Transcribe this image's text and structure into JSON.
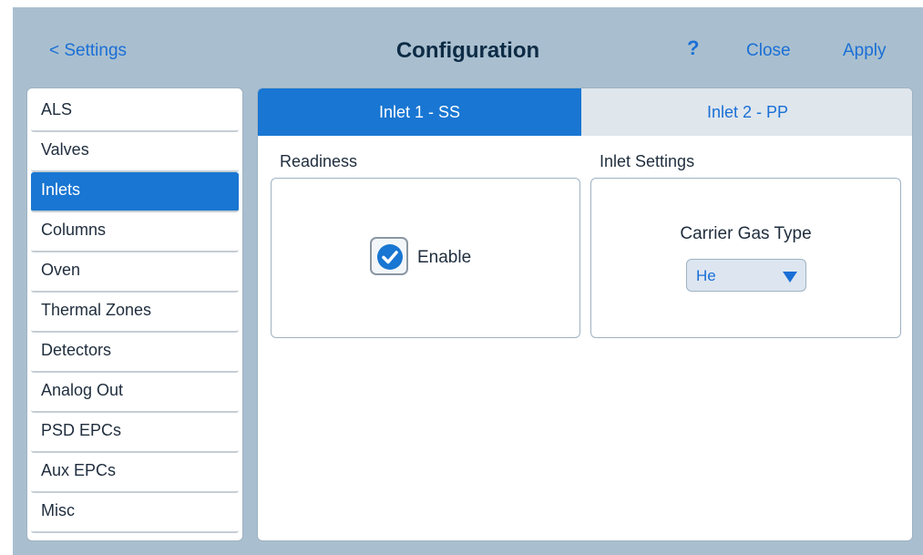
{
  "header": {
    "back_label": "< Settings",
    "title": "Configuration",
    "help_label": "?",
    "close_label": "Close",
    "apply_label": "Apply"
  },
  "sidebar": {
    "items": [
      {
        "label": "ALS"
      },
      {
        "label": "Valves"
      },
      {
        "label": "Inlets",
        "active": true
      },
      {
        "label": "Columns"
      },
      {
        "label": "Oven"
      },
      {
        "label": "Thermal Zones"
      },
      {
        "label": "Detectors"
      },
      {
        "label": "Analog Out"
      },
      {
        "label": "PSD EPCs"
      },
      {
        "label": "Aux EPCs"
      },
      {
        "label": "Misc"
      }
    ]
  },
  "tabs": [
    {
      "label": "Inlet 1 - SS",
      "active": true
    },
    {
      "label": "Inlet 2 - PP",
      "active": false
    }
  ],
  "readiness": {
    "section_label": "Readiness",
    "checkbox_label": "Enable",
    "checked": true
  },
  "inlet_settings": {
    "section_label": "Inlet Settings",
    "carrier_gas_label": "Carrier Gas Type",
    "carrier_gas_value": "He"
  },
  "colors": {
    "accent": "#1976d2",
    "link": "#1a6fd6",
    "background": "#a9bfcf"
  },
  "icons": {
    "checkbox": "checkmark-icon",
    "dropdown": "caret-down-icon"
  }
}
